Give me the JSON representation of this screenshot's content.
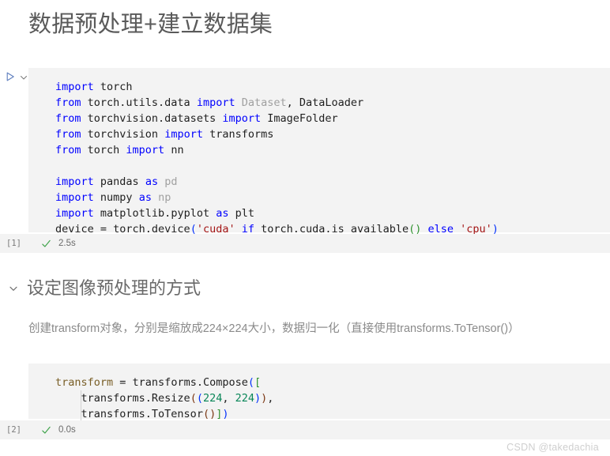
{
  "notebook": {
    "title": "数据预处理+建立数据集",
    "watermark": "CSDN @takedachia"
  },
  "cells": [
    {
      "id": "cell-1",
      "type": "code",
      "execution_count": "[1]",
      "status_icon": "check-icon",
      "exec_time": "2.5s",
      "run_icon": "play-triangle-icon",
      "collapse_icon": "chevron-down-icon",
      "lines": [
        "import torch",
        "from torch.utils.data import Dataset, DataLoader",
        "from torchvision.datasets import ImageFolder",
        "from torchvision import transforms",
        "from torch import nn",
        "",
        "import pandas as pd",
        "import numpy as np",
        "import matplotlib.pyplot as plt",
        "device = torch.device('cuda' if torch.cuda.is_available() else 'cpu')"
      ]
    },
    {
      "id": "cell-2",
      "type": "code",
      "execution_count": "[2]",
      "status_icon": "check-icon",
      "exec_time": "0.0s",
      "lines": [
        "transform = transforms.Compose([",
        "    transforms.Resize((224, 224)),",
        "    transforms.ToTensor()])"
      ]
    }
  ],
  "sections": [
    {
      "id": "section-2",
      "heading": "设定图像预处理的方式",
      "collapse_icon": "chevron-down-icon",
      "paragraph": "创建transform对象，分别是缩放成224×224大小，数据归一化（直接使用transforms.ToTensor()）"
    }
  ],
  "tokens": {
    "cell1": {
      "l1_kw": "import",
      "l1_mod": " torch",
      "l2_kw": "from",
      "l2_mod": " torch.utils.data ",
      "l2_kw2": "import",
      "l2_dim": " Dataset",
      "l2_sep": ", ",
      "l2_name": "DataLoader",
      "l3_kw": "from",
      "l3_mod": " torchvision.datasets ",
      "l3_kw2": "import",
      "l3_name": " ImageFolder",
      "l4_kw": "from",
      "l4_mod": " torchvision ",
      "l4_kw2": "import",
      "l4_name": " transforms",
      "l5_kw": "from",
      "l5_mod": " torch ",
      "l5_kw2": "import",
      "l5_name": " nn",
      "l7_kw": "import",
      "l7_mod": " pandas ",
      "l7_kw2": "as",
      "l7_alias": " pd",
      "l8_kw": "import",
      "l8_mod": " numpy ",
      "l8_kw2": "as",
      "l8_alias": " np",
      "l9_kw": "import",
      "l9_mod": " matplotlib.pyplot ",
      "l9_kw2": "as",
      "l9_alias": " plt",
      "l10_a": "device = torch.device",
      "l10_paren1": "(",
      "l10_str1": "'cuda'",
      "l10_sp1": " ",
      "l10_if": "if",
      "l10_mid": " torch.cuda.is_available",
      "l10_paren2": "()",
      "l10_sp2": " ",
      "l10_else": "else",
      "l10_sp3": " ",
      "l10_str2": "'cpu'",
      "l10_paren3": ")"
    },
    "cell2": {
      "l1_var": "transform",
      "l1_eq": " = ",
      "l1_call": "transforms.Compose",
      "l1_p1": "(",
      "l1_b1": "[",
      "l2_indent": "    ",
      "l2_call": "transforms.Resize",
      "l2_p1": "(",
      "l2_p2": "(",
      "l2_n1": "224",
      "l2_comma": ", ",
      "l2_n2": "224",
      "l2_p3": ")",
      "l2_p4": ")",
      "l2_end": ",",
      "l3_indent": "    ",
      "l3_call": "transforms.ToTensor",
      "l3_p1": "(",
      "l3_p2": ")",
      "l3_b1": "]",
      "l3_p3": ")"
    }
  }
}
